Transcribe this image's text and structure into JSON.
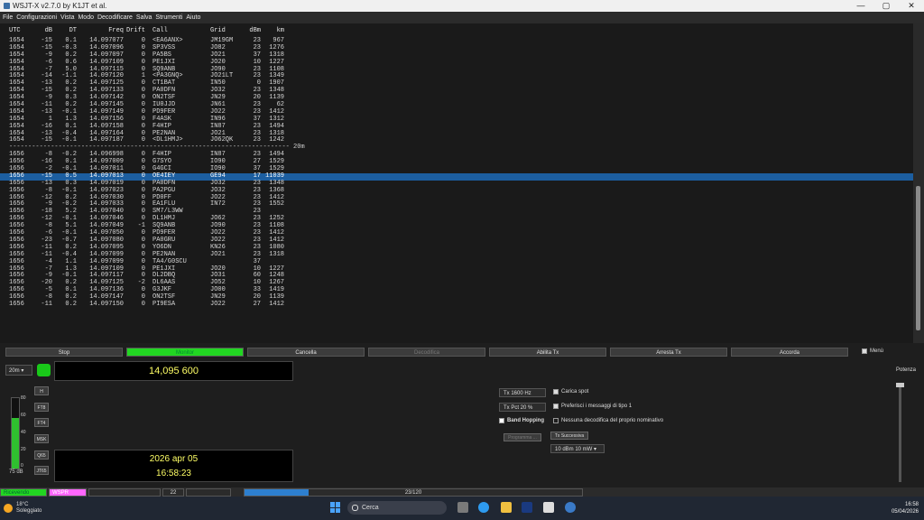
{
  "window": {
    "title": "WSJT-X   v2.7.0   by K1JT et al.",
    "controls": [
      "—",
      "▢",
      "✕"
    ]
  },
  "menu": [
    "File",
    "Configurazioni",
    "Vista",
    "Modo",
    "Decodificare",
    "Salva",
    "Strumenti",
    "Aiuto"
  ],
  "table": {
    "headers": [
      "UTC",
      "dB",
      "DT",
      "Freq",
      "Drift",
      "Call",
      "Grid",
      "dBm",
      "km"
    ],
    "rows1": [
      [
        "1654",
        "-15",
        "0.1",
        "14.097077",
        "0",
        "<EA6ANX>",
        "JM19GM",
        "23",
        "967"
      ],
      [
        "1654",
        "-15",
        "-0.3",
        "14.097096",
        "0",
        "SP3VSS",
        "JO82",
        "23",
        "1276"
      ],
      [
        "1654",
        "-9",
        "0.2",
        "14.097097",
        "0",
        "PA5BS",
        "JO21",
        "37",
        "1318"
      ],
      [
        "1654",
        "-6",
        "0.6",
        "14.097109",
        "0",
        "PE1JXI",
        "JO20",
        "10",
        "1227"
      ],
      [
        "1654",
        "-7",
        "5.0",
        "14.097115",
        "0",
        "SQ9ANB",
        "JO90",
        "23",
        "1108"
      ],
      [
        "1654",
        "-14",
        "-1.1",
        "14.097120",
        "1",
        "<PA3GNQ>",
        "JO21LT",
        "23",
        "1349"
      ],
      [
        "1654",
        "-13",
        "0.2",
        "14.097125",
        "0",
        "CT1BAT",
        "IN50",
        "0",
        "1907"
      ],
      [
        "1654",
        "-15",
        "0.2",
        "14.097133",
        "0",
        "PA0DFN",
        "JO32",
        "23",
        "1348"
      ],
      [
        "1654",
        "-9",
        "0.3",
        "14.097142",
        "0",
        "ON2TSF",
        "JN29",
        "20",
        "1139"
      ],
      [
        "1654",
        "-11",
        "0.2",
        "14.097145",
        "0",
        "IU0JJD",
        "JN61",
        "23",
        "62"
      ],
      [
        "1654",
        "-13",
        "-0.1",
        "14.097149",
        "0",
        "PD9FER",
        "JO22",
        "23",
        "1412"
      ],
      [
        "1654",
        "1",
        "1.3",
        "14.097156",
        "0",
        "F4ASK",
        "IN96",
        "37",
        "1312"
      ],
      [
        "1654",
        "-16",
        "0.1",
        "14.097158",
        "0",
        "F4HIP",
        "IN87",
        "23",
        "1494"
      ],
      [
        "1654",
        "-13",
        "-0.4",
        "14.097164",
        "0",
        "PE2NAN",
        "JO21",
        "23",
        "1318"
      ],
      [
        "1654",
        "-15",
        "-0.1",
        "14.097187",
        "0",
        "<DL1HMJ>",
        "JO62QK",
        "23",
        "1242"
      ]
    ],
    "separator": "-------------------------------------------------------------------------- 20m",
    "rows2": [
      [
        "1656",
        "-8",
        "-0.2",
        "14.096998",
        "0",
        "F4HIP",
        "IN87",
        "23",
        "1494"
      ],
      [
        "1656",
        "-16",
        "0.1",
        "14.097009",
        "0",
        "G7SYO",
        "IO90",
        "27",
        "1529"
      ],
      [
        "1656",
        "-2",
        "-0.1",
        "14.097011",
        "0",
        "G4GCI",
        "IO90",
        "37",
        "1529"
      ],
      [
        "1656",
        "-15",
        "0.5",
        "14.097013",
        "0",
        "OE4IEY",
        "GE94",
        "17",
        "11039"
      ],
      [
        "1656",
        "-13",
        "0.3",
        "14.097019",
        "0",
        "PA0DFN",
        "JO32",
        "23",
        "1348"
      ],
      [
        "1656",
        "-8",
        "-0.1",
        "14.097023",
        "0",
        "PA2PGU",
        "JO32",
        "23",
        "1368"
      ],
      [
        "1656",
        "-12",
        "0.2",
        "14.097030",
        "0",
        "PD0FF",
        "JO22",
        "23",
        "1412"
      ],
      [
        "1656",
        "-9",
        "-0.2",
        "14.097033",
        "0",
        "EA1FLU",
        "IN72",
        "23",
        "1552"
      ],
      [
        "1656",
        "-18",
        "5.2",
        "14.097040",
        "0",
        "SM7/L3WW",
        "",
        "23",
        ""
      ],
      [
        "1656",
        "-12",
        "-0.1",
        "14.097046",
        "0",
        "DL1HMJ",
        "JO62",
        "23",
        "1252"
      ],
      [
        "1656",
        "-8",
        "5.1",
        "14.097049",
        "-1",
        "SQ9ANB",
        "JO90",
        "23",
        "1108"
      ],
      [
        "1656",
        "-6",
        "-0.1",
        "14.097050",
        "0",
        "PD9FER",
        "JO22",
        "23",
        "1412"
      ],
      [
        "1656",
        "-23",
        "-0.7",
        "14.097080",
        "0",
        "PA0GRU",
        "JO22",
        "23",
        "1412"
      ],
      [
        "1656",
        "-11",
        "0.2",
        "14.097095",
        "0",
        "YO6DN",
        "KN26",
        "23",
        "1080"
      ],
      [
        "1656",
        "-11",
        "-0.4",
        "14.097099",
        "0",
        "PE2NAN",
        "JO21",
        "23",
        "1318"
      ],
      [
        "1656",
        "-4",
        "1.1",
        "14.097099",
        "0",
        "TA4/G0SCU",
        "",
        "37",
        ""
      ],
      [
        "1656",
        "-7",
        "1.3",
        "14.097109",
        "0",
        "PE1JXI",
        "JO20",
        "10",
        "1227"
      ],
      [
        "1656",
        "-9",
        "-0.1",
        "14.097117",
        "0",
        "DL2DBQ",
        "JO31",
        "60",
        "1248"
      ],
      [
        "1656",
        "-20",
        "0.2",
        "14.097125",
        "-2",
        "DL6AAS",
        "JO52",
        "10",
        "1267"
      ],
      [
        "1656",
        "-5",
        "0.1",
        "14.097136",
        "0",
        "G3JKF",
        "JO00",
        "33",
        "1419"
      ],
      [
        "1656",
        "-8",
        "0.2",
        "14.097147",
        "0",
        "ON2TSF",
        "JN29",
        "20",
        "1139"
      ],
      [
        "1656",
        "-11",
        "0.2",
        "14.097150",
        "0",
        "PI9ESA",
        "JO22",
        "27",
        "1412"
      ]
    ],
    "selected_row2_index": 3
  },
  "buttons": {
    "stop": "Stop",
    "monitor": "Monitor",
    "cancella": "Cancella",
    "decodifica": "Decodifica",
    "abilita": "Abilita Tx",
    "arresta": "Arresta Tx",
    "accorda": "Accorda",
    "menu": "Menù"
  },
  "band": "20m",
  "frequency": "14,095 600",
  "meter": {
    "ticks": [
      "80",
      "60",
      "40",
      "20",
      "0"
    ],
    "label": "75 dB",
    "level_db": 75,
    "fill": 0.72
  },
  "modes": [
    "H",
    "FT8",
    "FT4",
    "MSK",
    "Q65",
    "JT65"
  ],
  "date": "2026 apr 05",
  "time": "16:58:23",
  "controls": {
    "tx_hz": "Tx  1600  Hz",
    "tx_pct": "Tx Pct 20  %",
    "carica_spot": "Carica spot",
    "preferisci": "Preferisci i messaggi di tipo 1",
    "band_hopping": "Band Hopping",
    "nessuna": "Nessuna decodifica del proprio nominativo",
    "programma": "Programma ...",
    "tx_successiva": "Tx Successiva",
    "power": "10 dBm   10 mW"
  },
  "potenza": "Potenza",
  "status": {
    "receiving": "Ricevendo",
    "mode": "WSPR",
    "num": "22",
    "progress_label": "23/120",
    "progress": 0.19
  },
  "taskbar": {
    "temp": "18°C",
    "weather": "Soleggiato",
    "search": "Cerca",
    "time": "16:58",
    "date": "05/04/2026"
  }
}
